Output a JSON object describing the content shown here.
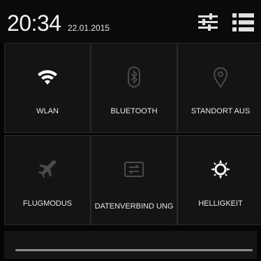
{
  "status": {
    "time": "20:34",
    "date": "22.01.2015"
  },
  "header_icons": {
    "settings": "settings-sliders-icon",
    "list": "notification-list-icon"
  },
  "tiles": [
    {
      "label": "WLAN",
      "icon": "wifi-icon",
      "active": true
    },
    {
      "label": "BLUETOOTH",
      "icon": "bluetooth-icon",
      "active": false
    },
    {
      "label": "STANDORT AUS",
      "icon": "location-pin-icon",
      "active": false
    },
    {
      "label": "FLUGMODUS",
      "icon": "airplane-icon",
      "active": false
    },
    {
      "label": "DATENVERBIND UNG",
      "icon": "data-connection-icon",
      "active": false
    },
    {
      "label": "HELLIGKEIT",
      "icon": "brightness-icon",
      "active": true
    }
  ],
  "colors": {
    "active_icon": "#ffffff",
    "inactive_icon": "#4a4a4a",
    "label": "#e8e8e8",
    "background": "#050505",
    "tile": "#141414"
  }
}
